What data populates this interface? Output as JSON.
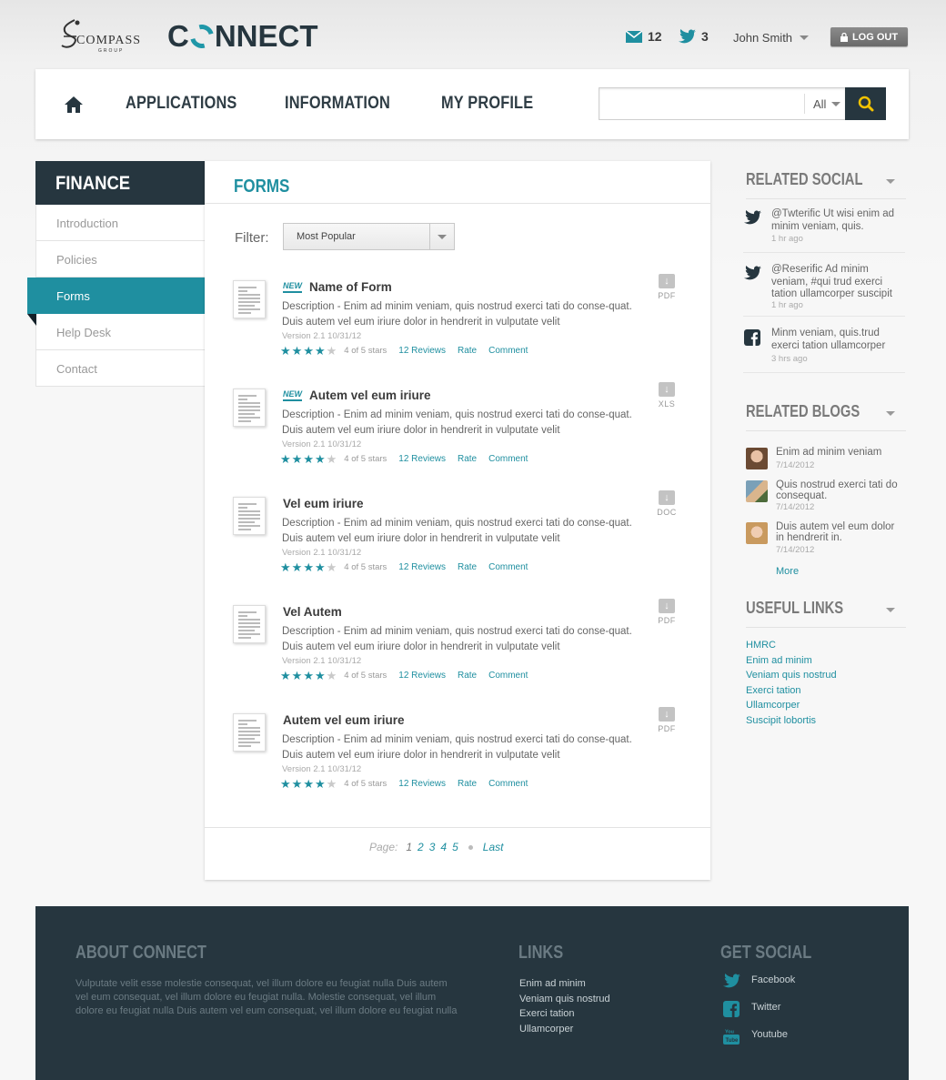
{
  "header": {
    "brand_compass": "COMPASS",
    "brand_group": "GROUP",
    "brand_connect_pre": "C",
    "brand_connect_post": "NNECT",
    "messages_count": "12",
    "tweets_count": "3",
    "user_name": "John Smith",
    "logout_label": "LOG OUT"
  },
  "nav": {
    "items": [
      "APPLICATIONS",
      "INFORMATION",
      "MY PROFILE"
    ],
    "search_placeholder": "",
    "search_scope": "All"
  },
  "sidebar": {
    "title": "FINANCE",
    "items": [
      "Introduction",
      "Policies",
      "Forms",
      "Help Desk",
      "Contact"
    ],
    "active": "Forms"
  },
  "main": {
    "title": "FORMS",
    "filter_label": "Filter:",
    "filter_value": "Most Popular",
    "forms": [
      {
        "title": "Name of Form",
        "is_new": true,
        "badge": "NEW",
        "desc": "Description - Enim ad minim veniam, quis nostrud exerci tati do conse-quat. Duis autem vel eum iriure dolor in hendrerit in vulputate velit",
        "version": "Version 2.1 10/31/12",
        "rating": 4,
        "rating_text": "4 of 5 stars",
        "reviews": "12 Reviews",
        "rate": "Rate",
        "comment": "Comment",
        "type": "PDF"
      },
      {
        "title": "Autem vel eum iriure",
        "is_new": true,
        "badge": "NEW",
        "desc": "Description - Enim ad minim veniam, quis nostrud exerci tati do conse-quat. Duis autem vel eum iriure dolor in hendrerit in vulputate velit",
        "version": "Version 2.1 10/31/12",
        "rating": 4,
        "rating_text": "4 of 5 stars",
        "reviews": "12 Reviews",
        "rate": "Rate",
        "comment": "Comment",
        "type": "XLS"
      },
      {
        "title": "Vel eum iriure",
        "is_new": false,
        "badge": "",
        "desc": "Description - Enim ad minim veniam, quis nostrud exerci tati do conse-quat. Duis autem vel eum iriure dolor in hendrerit in vulputate velit",
        "version": "Version 2.1 10/31/12",
        "rating": 4,
        "rating_text": "4 of 5 stars",
        "reviews": "12 Reviews",
        "rate": "Rate",
        "comment": "Comment",
        "type": "DOC"
      },
      {
        "title": "Vel Autem",
        "is_new": false,
        "badge": "",
        "desc": "Description - Enim ad minim veniam, quis nostrud exerci tati do conse-quat. Duis autem vel eum iriure dolor in hendrerit in vulputate velit",
        "version": "Version 2.1 10/31/12",
        "rating": 4,
        "rating_text": "4 of 5 stars",
        "reviews": "12 Reviews",
        "rate": "Rate",
        "comment": "Comment",
        "type": "PDF"
      },
      {
        "title": "Autem vel eum iriure",
        "is_new": false,
        "badge": "",
        "desc": "Description - Enim ad minim veniam, quis nostrud exerci tati do conse-quat. Duis autem vel eum iriure dolor in hendrerit in vulputate velit",
        "version": "Version 2.1 10/31/12",
        "rating": 4,
        "rating_text": "4 of 5 stars",
        "reviews": "12 Reviews",
        "rate": "Rate",
        "comment": "Comment",
        "type": "PDF"
      }
    ],
    "pager": {
      "label": "Page:",
      "current": "1",
      "pages": [
        "2",
        "3",
        "4",
        "5"
      ],
      "last": "Last"
    }
  },
  "right": {
    "social_title": "RELATED SOCIAL",
    "social": [
      {
        "icon": "twitter-icon",
        "text": "@Twterific Ut wisi enim ad minim veniam, quis.",
        "when": "1 hr ago"
      },
      {
        "icon": "twitter-icon",
        "text": "@Reserific Ad minim veniam, #qui trud exerci tation ullamcorper suscipit",
        "when": "1 hr ago"
      },
      {
        "icon": "facebook-icon",
        "text": "Minm veniam, quis.trud exerci tation ullamcorper",
        "when": "3 hrs ago"
      }
    ],
    "blogs_title": "RELATED BLOGS",
    "blogs": [
      {
        "text": "Enim ad minim veniam",
        "date": "7/14/2012"
      },
      {
        "text": "Quis nostrud exerci tati do consequat.",
        "date": "7/14/2012"
      },
      {
        "text": "Duis autem vel eum dolor in hendrerit in.",
        "date": "7/14/2012"
      }
    ],
    "more_label": "More",
    "links_title": "USEFUL LINKS",
    "links": [
      "HMRC",
      "Enim ad minim",
      "Veniam quis nostrud",
      "Exerci tation",
      "Ullamcorper",
      "Suscipit lobortis"
    ]
  },
  "footer": {
    "about_title": "ABOUT CONNECT",
    "about_text": "Vulputate velit esse molestie consequat, vel illum dolore eu feugiat nulla Duis autem vel eum consequat, vel illum dolore eu feugiat nulla.  Molestie consequat, vel illum dolore eu feugiat nulla Duis autem vel eum consequat, vel illum dolore eu feugiat nulla",
    "links_title": "LINKS",
    "links": [
      "Enim ad minim",
      "Veniam quis nostrud",
      "Exerci tation",
      "Ullamcorper"
    ],
    "social_title": "GET SOCIAL",
    "social": [
      "Facebook",
      "Twitter",
      "Youtube"
    ]
  },
  "colors": {
    "accent": "#1f8fa0",
    "dark": "#26363f"
  }
}
